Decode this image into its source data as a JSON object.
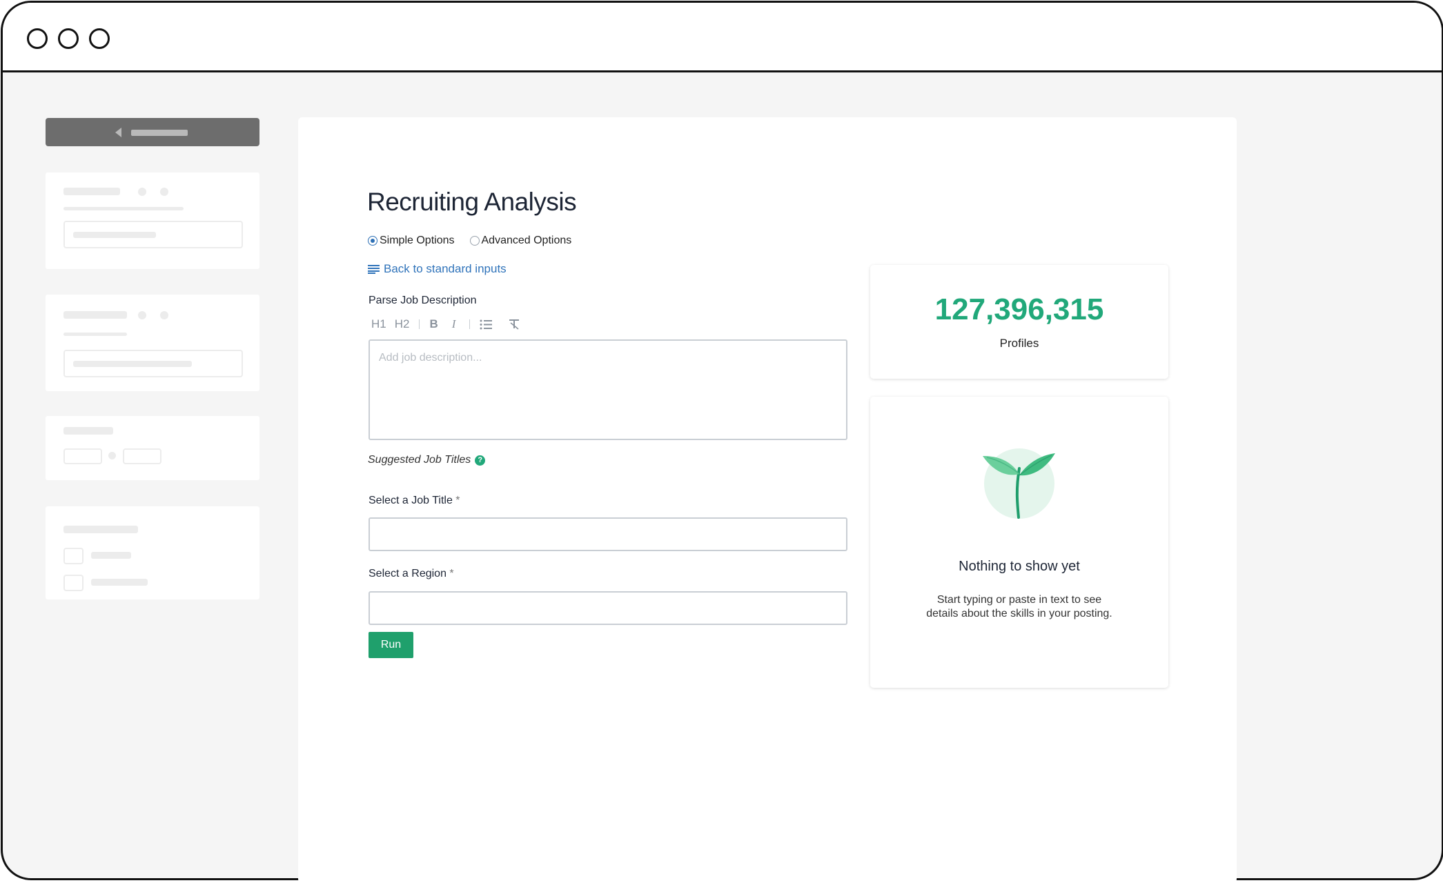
{
  "page": {
    "title": "Recruiting Analysis"
  },
  "options": {
    "simple_label": "Simple Options",
    "advanced_label": "Advanced Options",
    "selected": "Simple Options"
  },
  "back_link": {
    "label": "Back to standard inputs"
  },
  "job_description": {
    "label": "Parse Job Description",
    "placeholder": "Add job description...",
    "toolbar": [
      "H1",
      "H2",
      "B",
      "I"
    ]
  },
  "suggested": {
    "label": "Suggested Job Titles"
  },
  "job_title": {
    "label": "Select a Job Title",
    "required_mark": "*",
    "value": ""
  },
  "region": {
    "label": "Select a Region",
    "required_mark": "*",
    "value": ""
  },
  "run_button": {
    "label": "Run"
  },
  "stats": {
    "count": "127,396,315",
    "label": "Profiles"
  },
  "empty_state": {
    "title": "Nothing to show yet",
    "description": "Start typing or paste in text to see details about the skills in your posting."
  },
  "colors": {
    "accent_green": "#21a87a",
    "link_blue": "#2f73ba",
    "run_button": "#1fa06c"
  }
}
